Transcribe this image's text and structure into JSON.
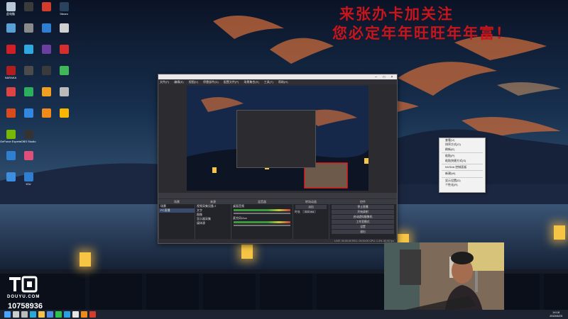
{
  "promo": {
    "line1": "来张办卡加关注",
    "line2": "您必定年年旺旺年年富！"
  },
  "desktop_icons": [
    {
      "label": "此电脑",
      "color": "#b8c7da"
    },
    {
      "label": "",
      "color": "#3a3a3a"
    },
    {
      "label": "",
      "color": "#d33b2c"
    },
    {
      "label": "Steam",
      "color": "#29425e"
    },
    {
      "label": "",
      "color": "#5aa0d8"
    },
    {
      "label": "",
      "color": "#8a8a8a"
    },
    {
      "label": "",
      "color": "#2f7fd0"
    },
    {
      "label": "",
      "color": "#d0d0d0"
    },
    {
      "label": "",
      "color": "#d11f28"
    },
    {
      "label": "",
      "color": "#2fa7e0"
    },
    {
      "label": "",
      "color": "#6b3fa0"
    },
    {
      "label": "",
      "color": "#d62e2e"
    },
    {
      "label": "NARAKA",
      "color": "#b21d1d"
    },
    {
      "label": "",
      "color": "#4b4b4b"
    },
    {
      "label": "",
      "color": "#3a3a3a"
    },
    {
      "label": "",
      "color": "#3fb85a"
    },
    {
      "label": "",
      "color": "#d44"
    },
    {
      "label": "",
      "color": "#2dae5e"
    },
    {
      "label": "",
      "color": "#f0a020"
    },
    {
      "label": "",
      "color": "#bbb"
    },
    {
      "label": "",
      "color": "#d94b1c"
    },
    {
      "label": "",
      "color": "#3288e0"
    },
    {
      "label": "",
      "color": "#f28a1a"
    },
    {
      "label": "",
      "color": "#f7b700"
    },
    {
      "label": "GeForce Experience",
      "color": "#76b900"
    },
    {
      "label": "OBS Studio",
      "color": "#333"
    },
    {
      "label": "",
      "color": "#2f7fd0"
    },
    {
      "label": "",
      "color": "#e04e7a"
    },
    {
      "label": "",
      "color": "#3b8ee0"
    },
    {
      "label": "IOU",
      "color": "#2f7fd0"
    }
  ],
  "obs": {
    "menu": [
      "文件(F)",
      "编辑(E)",
      "视图(V)",
      "停靠部件(D)",
      "配置文件(P)",
      "场景集合(S)",
      "工具(T)",
      "帮助(H)"
    ],
    "scenes_header": "场景",
    "scenes": [
      "场景",
      "PC直播"
    ],
    "sources_header": "来源",
    "sources": [
      "视频采集设备 2",
      "文字",
      "图像",
      "显示器采集",
      "媒体源"
    ],
    "mixer_header": "混音器",
    "mixer_tracks": [
      "桌面音频",
      "麦克风/Aux"
    ],
    "transition_header": "转场动画",
    "transition_value": "淡出",
    "duration_label": "时长",
    "duration_value": "300 ms",
    "controls_header": "控件",
    "controls": [
      "停止直播",
      "开始录制",
      "启动虚拟摄像机",
      "工作室模式",
      "设置",
      "退出"
    ],
    "status": "LIVE: 00:00:00   REC: 00:00:00   CPU: 1.4%, 60.00 fps"
  },
  "context_menu": [
    "查看(V)",
    "排序方式(O)",
    "刷新(E)",
    "",
    "粘贴(P)",
    "粘贴快捷方式(S)",
    "",
    "NVIDIA 控制面板",
    "",
    "新建(W)",
    "",
    "显示设置(D)",
    "个性化(R)"
  ],
  "watermark": {
    "brand": "DOUYU.COM",
    "room_id": "10758936"
  },
  "clock": {
    "time": "14:18",
    "date": "2022/6/23"
  },
  "taskbar_icons": [
    {
      "name": "start-icon",
      "color": "#4aa3ff"
    },
    {
      "name": "search-icon",
      "color": "#cccccc"
    },
    {
      "name": "task-view-icon",
      "color": "#bbbbbb"
    },
    {
      "name": "edge-icon",
      "color": "#2aa8d8"
    },
    {
      "name": "explorer-icon",
      "color": "#f2c14e"
    },
    {
      "name": "store-icon",
      "color": "#4c8ce0"
    },
    {
      "name": "wechat-icon",
      "color": "#2dc24d"
    },
    {
      "name": "qq-icon",
      "color": "#28a0e8"
    },
    {
      "name": "obs-icon",
      "color": "#e5e5e5"
    },
    {
      "name": "app-icon",
      "color": "#f28a1a"
    },
    {
      "name": "app-icon",
      "color": "#d33b2c"
    }
  ]
}
